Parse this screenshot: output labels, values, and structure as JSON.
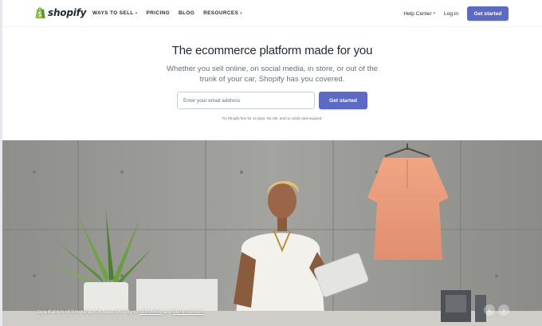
{
  "brand": {
    "name": "shopify",
    "logo_icon": "shopping-bag-icon",
    "logo_color": "#95bf47"
  },
  "nav": {
    "left": [
      {
        "label": "WAYS TO SELL",
        "has_caret": true
      },
      {
        "label": "PRICING",
        "has_caret": false
      },
      {
        "label": "BLOG",
        "has_caret": false
      },
      {
        "label": "RESOURCES",
        "has_caret": true
      }
    ],
    "help_center": "Help Center",
    "login": "Log in",
    "cta": "Get started"
  },
  "hero": {
    "title": "The ecommerce platform made for you",
    "subtitle_line1": "Whether you sell online, on social media, in store, or out of the",
    "subtitle_line2": "trunk of your car, Shopify has you covered.",
    "email_placeholder": "Enter your email address",
    "cta": "Get started",
    "fine_print": "Try Shopify free for 14 days. No risk, and no credit card required."
  },
  "photo": {
    "caption_prefix": "Jaya Kahlon of Smoke & Ash uses Shopify to ",
    "caption_link1": "sell online",
    "caption_mid": " and ",
    "caption_link2": "sell in person",
    "prev_icon": "chevron-left-icon",
    "next_icon": "chevron-right-icon",
    "prev_glyph": "‹",
    "next_glyph": "›"
  },
  "colors": {
    "accent": "#5c6ac4",
    "text": "#212b36",
    "muted": "#637381"
  }
}
